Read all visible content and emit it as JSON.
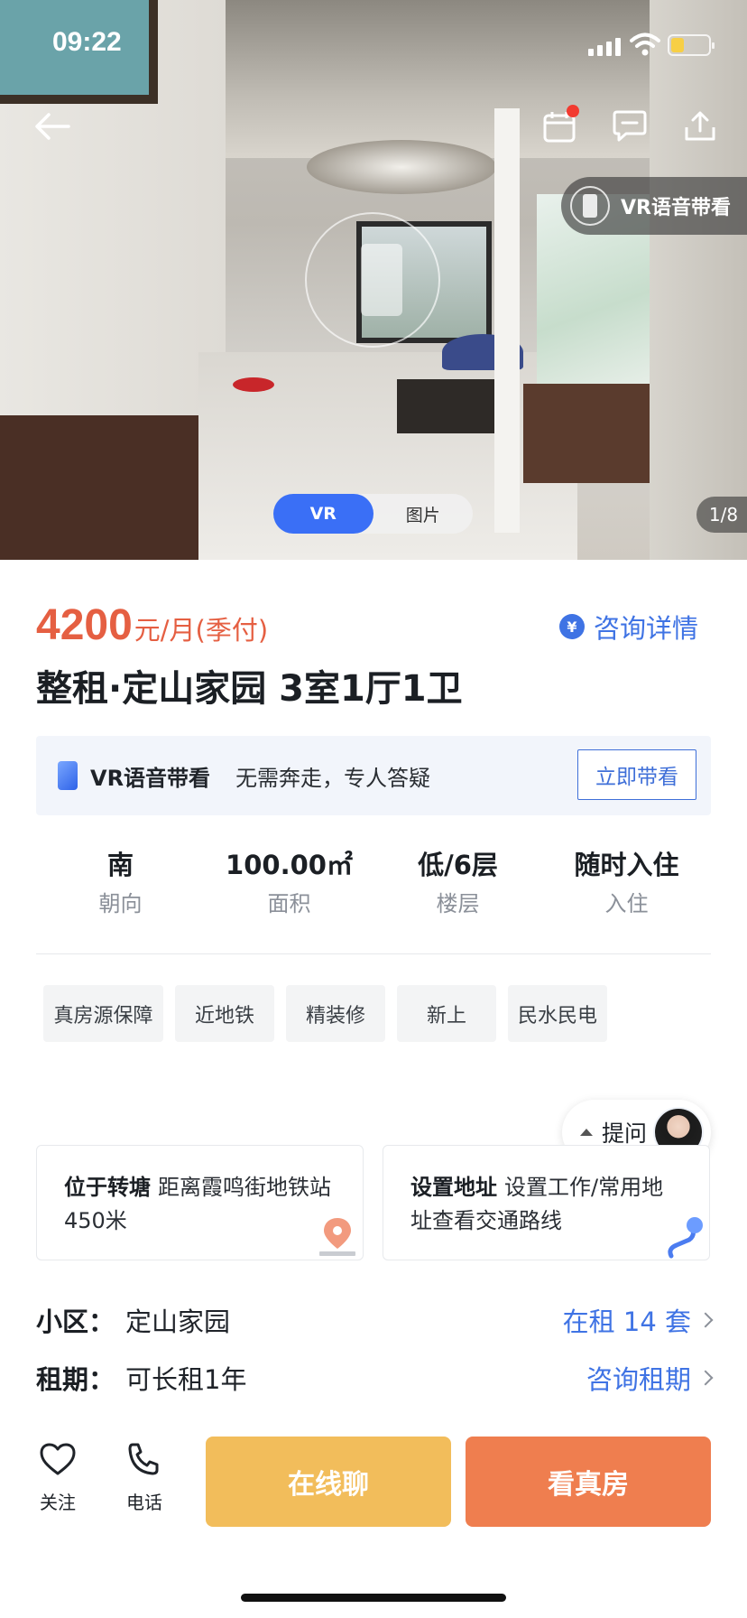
{
  "status_bar": {
    "time": "09:22"
  },
  "hero": {
    "vr_voice_label": "VR语音带看",
    "toggle": {
      "vr": "VR",
      "photos": "图片"
    },
    "photo_counter": "1/8"
  },
  "listing": {
    "price": "4200",
    "price_unit": "元/月(季付)",
    "consult_label": "咨询详情",
    "title": "整租·定山家园 3室1厅1卫"
  },
  "vr_banner": {
    "title": "VR语音带看",
    "desc": "无需奔走，专人答疑",
    "button": "立即带看"
  },
  "facts": [
    {
      "value": "南",
      "label": "朝向"
    },
    {
      "value": "100.00㎡",
      "label": "面积"
    },
    {
      "value": "低/6层",
      "label": "楼层"
    },
    {
      "value": "随时入住",
      "label": "入住"
    }
  ],
  "tags": [
    "真房源保障",
    "近地铁",
    "精装修",
    "新上",
    "民水民电"
  ],
  "ask": {
    "label": "提问"
  },
  "location_card": {
    "bold": "位于转塘",
    "text": "距离霞鸣街地铁站450米"
  },
  "address_card": {
    "bold": "设置地址",
    "text": "设置工作/常用地址查看交通路线"
  },
  "community": {
    "key": "小区：",
    "value": "定山家园",
    "link": "在租 14 套"
  },
  "lease": {
    "key": "租期：",
    "value": "可长租1年",
    "link": "咨询租期"
  },
  "bottom_bar": {
    "follow": "关注",
    "phone": "电话",
    "chat": "在线聊",
    "view": "看真房"
  },
  "colors": {
    "price": "#e55f42",
    "link_blue": "#3f73e4",
    "chat_button": "#f2bd5b",
    "view_button": "#ef7e4f",
    "vr_active": "#3a6ff6"
  }
}
